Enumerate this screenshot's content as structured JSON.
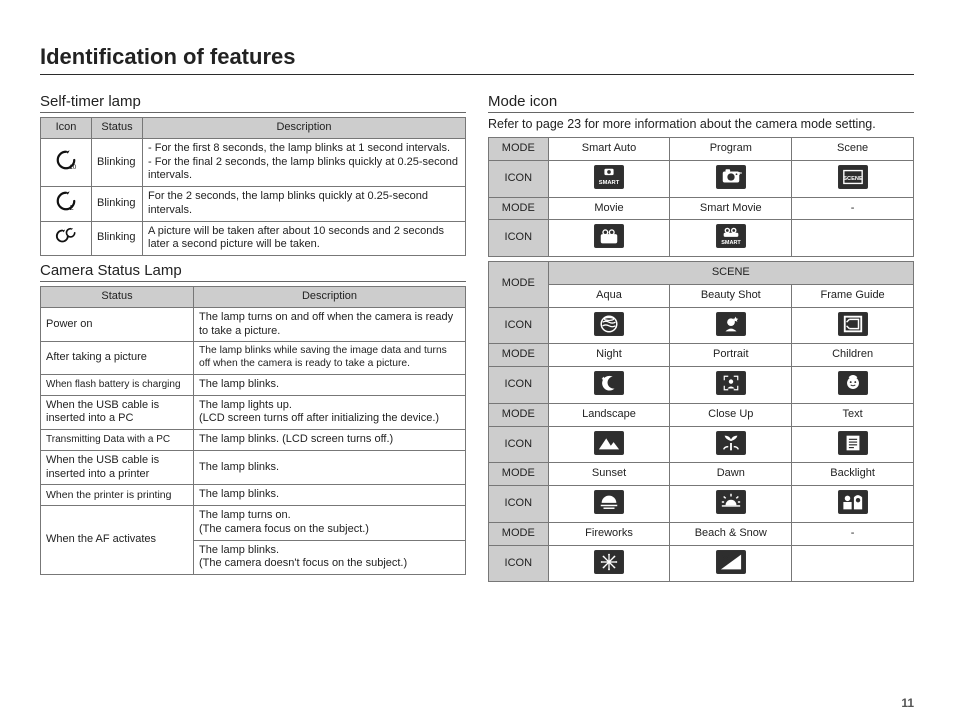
{
  "pageTitle": "Identification of features",
  "pageNumber": "11",
  "left": {
    "selfTimer": {
      "title": "Self-timer lamp",
      "headers": [
        "Icon",
        "Status",
        "Description"
      ],
      "rows": [
        {
          "iconName": "timer-10s-icon",
          "status": "Blinking",
          "desc": "- For the first 8 seconds, the lamp blinks at 1 second intervals.\n- For the final 2 seconds, the lamp blinks quickly at 0.25-second intervals."
        },
        {
          "iconName": "timer-2s-icon",
          "status": "Blinking",
          "desc": "For the 2 seconds, the lamp blinks quickly at 0.25-second intervals."
        },
        {
          "iconName": "timer-double-icon",
          "status": "Blinking",
          "desc": "A picture will be taken after about 10 seconds and 2 seconds later a second picture will be taken."
        }
      ]
    },
    "status": {
      "title": "Camera Status Lamp",
      "headers": [
        "Status",
        "Description"
      ],
      "rows": [
        {
          "status": "Power on",
          "desc": "The lamp turns on and off when the camera is ready to take a picture."
        },
        {
          "status": "After taking a picture",
          "desc": "The lamp blinks while saving the image data and turns off when the camera is ready to take a picture."
        },
        {
          "status": "When flash battery is charging",
          "desc": "The lamp blinks."
        },
        {
          "status": "When the USB cable is inserted into a PC",
          "desc": "The lamp lights up.\n(LCD screen turns off after initializing the device.)"
        },
        {
          "status": "Transmitting Data with a PC",
          "desc": "The lamp blinks. (LCD screen turns off.)"
        },
        {
          "status": "When the USB cable is inserted into a printer",
          "desc": "The lamp blinks."
        },
        {
          "status": "When the printer is printing",
          "desc": "The lamp blinks."
        }
      ],
      "afRow": {
        "status": "When the AF activates",
        "desc1": "The lamp turns on.\n(The camera focus on the subject.)",
        "desc2": "The lamp blinks.\n(The camera doesn't focus on the subject.)"
      }
    }
  },
  "right": {
    "modeIcon": {
      "title": "Mode icon",
      "note": "Refer to page 23 for more information about the camera mode setting.",
      "labels": {
        "mode": "MODE",
        "icon": "ICON",
        "scene": "SCENE"
      },
      "primary": [
        {
          "modes": [
            "Smart Auto",
            "Program",
            "Scene"
          ],
          "icons": [
            "smart-auto-icon",
            "program-icon",
            "scene-icon"
          ]
        },
        {
          "modes": [
            "Movie",
            "Smart Movie",
            "-"
          ],
          "icons": [
            "movie-icon",
            "smart-movie-icon",
            ""
          ]
        }
      ],
      "sceneRows": [
        {
          "modes": [
            "Aqua",
            "Beauty Shot",
            "Frame Guide"
          ],
          "icons": [
            "aqua-icon",
            "beauty-shot-icon",
            "frame-guide-icon"
          ]
        },
        {
          "modes": [
            "Night",
            "Portrait",
            "Children"
          ],
          "icons": [
            "night-icon",
            "portrait-icon",
            "children-icon"
          ]
        },
        {
          "modes": [
            "Landscape",
            "Close Up",
            "Text"
          ],
          "icons": [
            "landscape-icon",
            "closeup-icon",
            "text-icon"
          ]
        },
        {
          "modes": [
            "Sunset",
            "Dawn",
            "Backlight"
          ],
          "icons": [
            "sunset-icon",
            "dawn-icon",
            "backlight-icon"
          ]
        },
        {
          "modes": [
            "Fireworks",
            "Beach & Snow",
            "-"
          ],
          "icons": [
            "fireworks-icon",
            "beach-snow-icon",
            ""
          ]
        }
      ]
    }
  }
}
